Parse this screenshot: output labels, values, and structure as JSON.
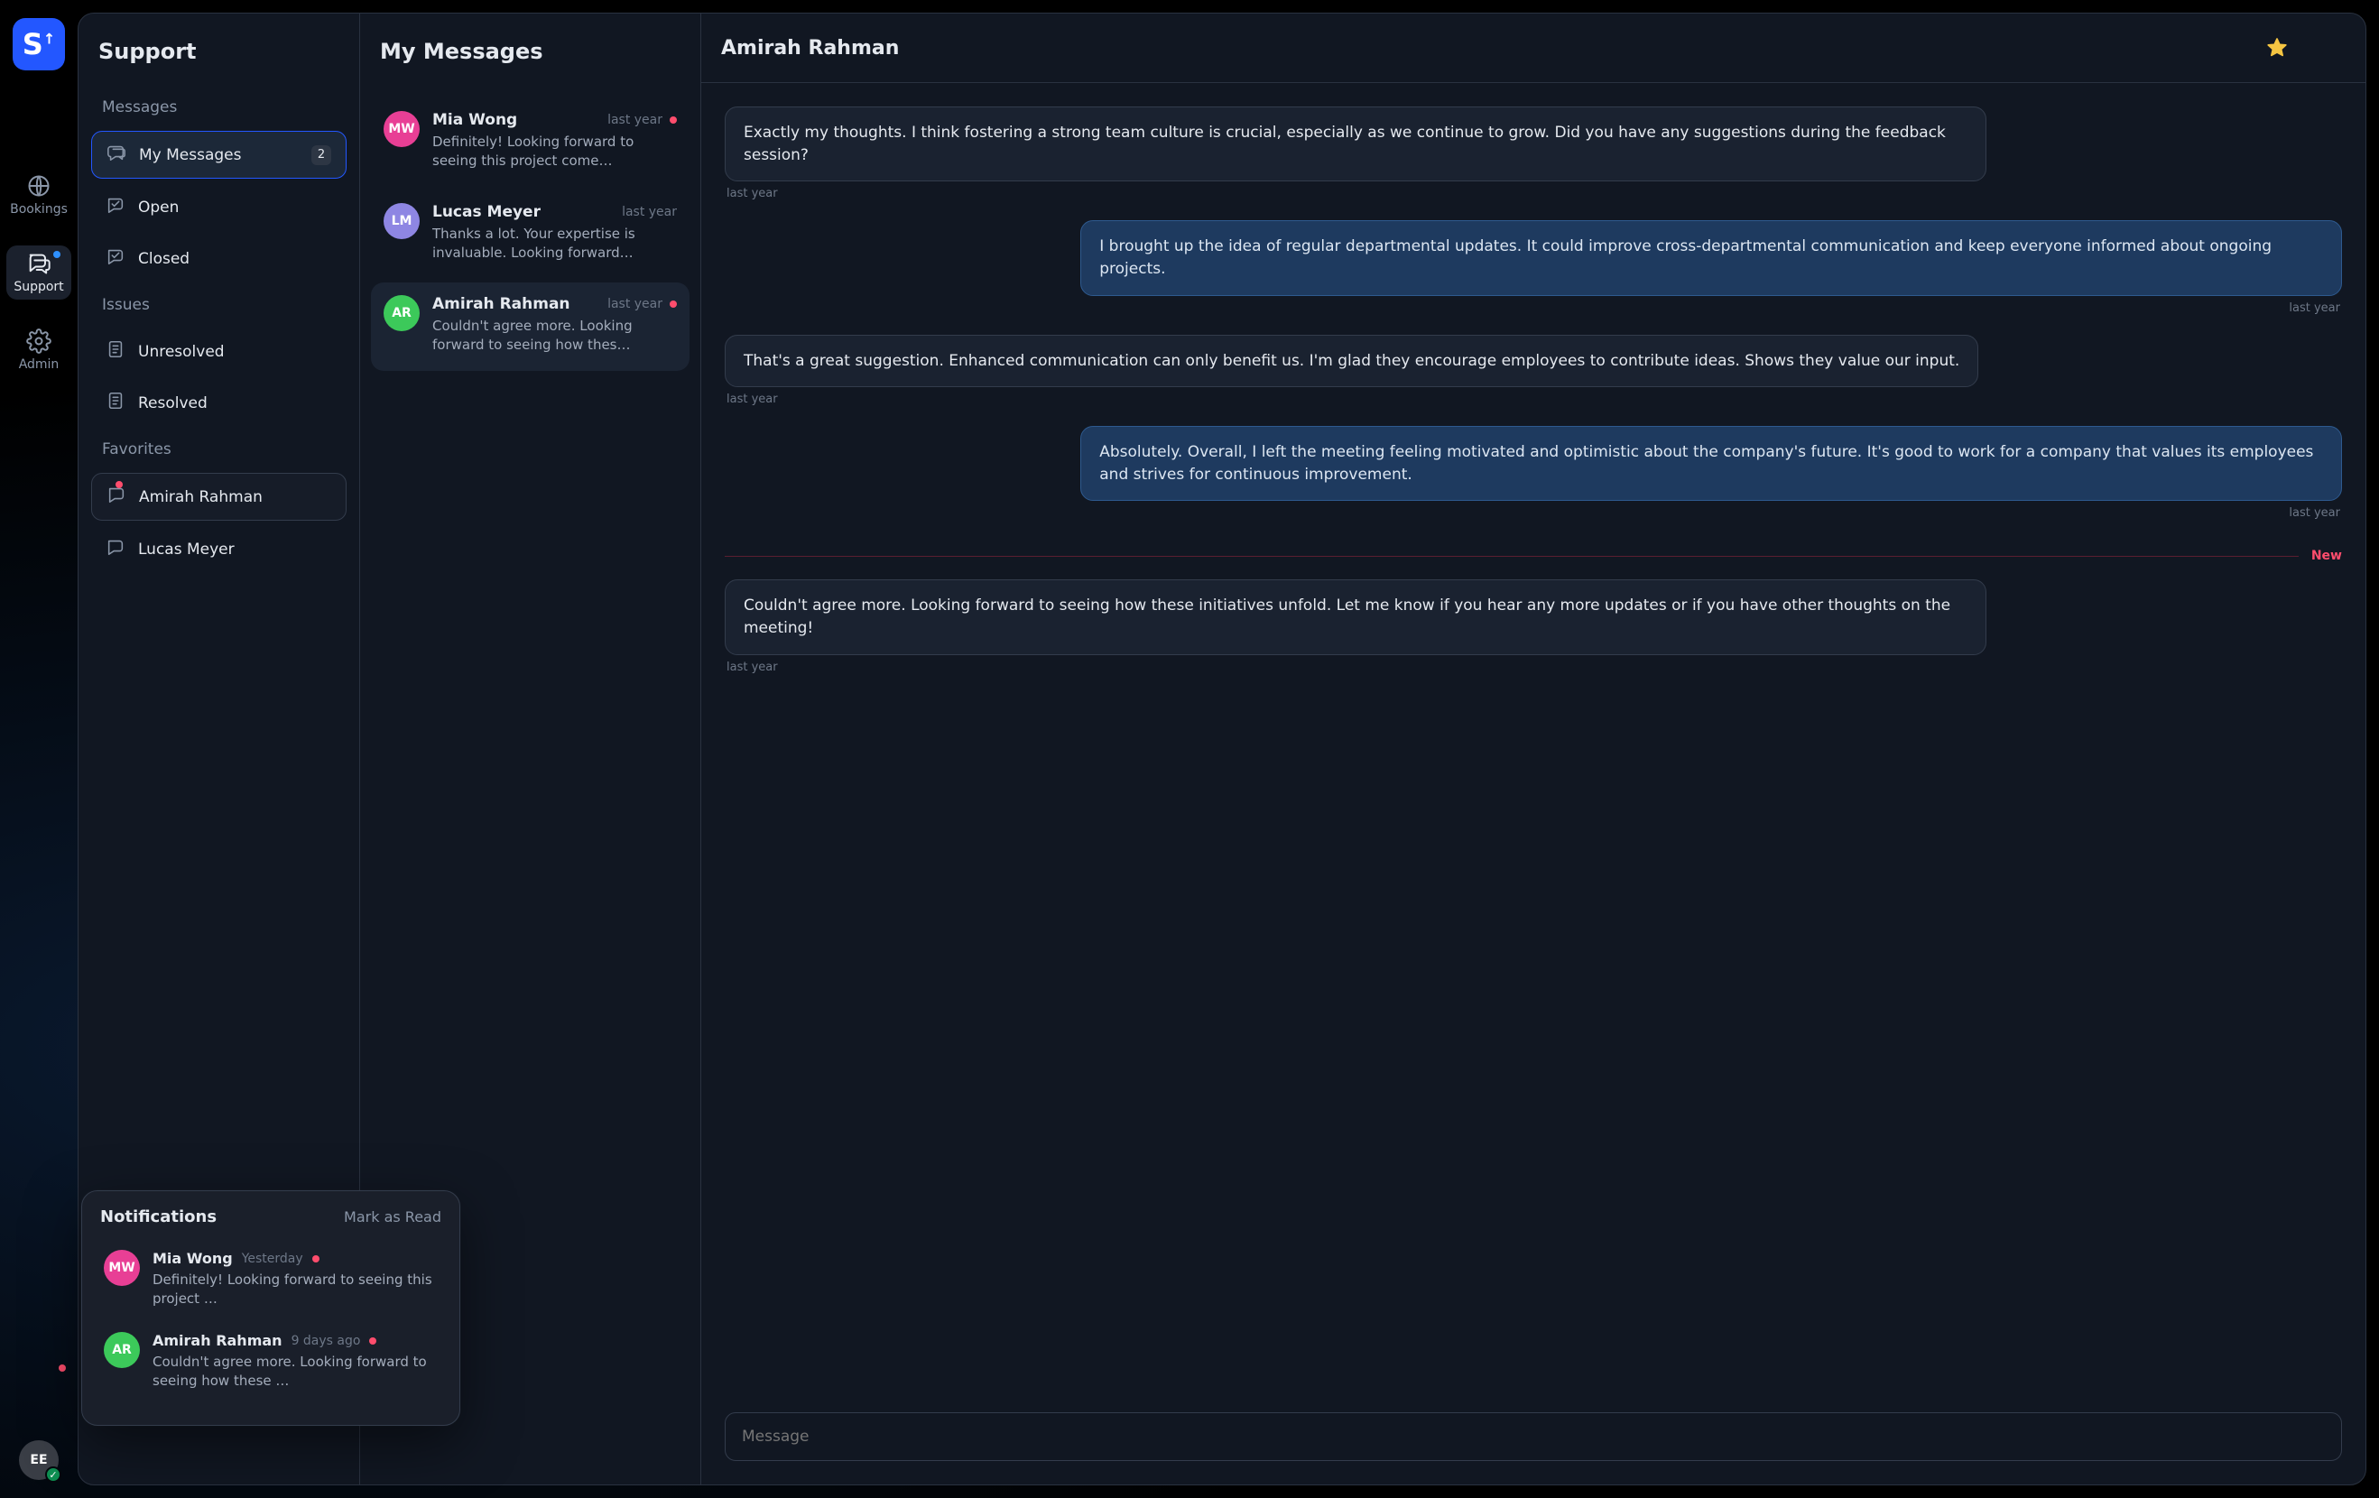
{
  "rail": {
    "items": [
      {
        "icon": "globe",
        "label": "Bookings"
      },
      {
        "icon": "chat",
        "label": "Support",
        "active": true,
        "indicator": true
      },
      {
        "icon": "gear",
        "label": "Admin"
      }
    ],
    "avatar_initials": "EE"
  },
  "support": {
    "title": "Support",
    "sections": [
      {
        "label": "Messages",
        "items": [
          {
            "icon": "chat-bubble",
            "label": "My Messages",
            "count": "2",
            "active": true
          },
          {
            "icon": "check-msg",
            "label": "Open"
          },
          {
            "icon": "check-msg",
            "label": "Closed"
          }
        ]
      },
      {
        "label": "Issues",
        "items": [
          {
            "icon": "doc",
            "label": "Unresolved"
          },
          {
            "icon": "doc",
            "label": "Resolved"
          }
        ]
      },
      {
        "label": "Favorites",
        "items": [
          {
            "icon": "msg",
            "label": "Amirah Rahman",
            "boxed": true,
            "dot": true
          },
          {
            "icon": "msg",
            "label": "Lucas Meyer"
          }
        ]
      }
    ]
  },
  "list": {
    "title": "My Messages",
    "items": [
      {
        "initials": "MW",
        "avatar_class": "av-pink",
        "name": "Mia Wong",
        "time": "last year",
        "unread": true,
        "preview": "Definitely! Looking forward to seeing this project come…"
      },
      {
        "initials": "LM",
        "avatar_class": "av-violet",
        "name": "Lucas Meyer",
        "time": "last year",
        "unread": false,
        "preview": "Thanks a lot. Your expertise is invaluable. Looking forward…"
      },
      {
        "initials": "AR",
        "avatar_class": "av-green",
        "name": "Amirah Rahman",
        "time": "last year",
        "unread": true,
        "active": true,
        "preview": "Couldn't agree more. Looking forward to seeing how thes…"
      }
    ]
  },
  "conversation": {
    "title": "Amirah Rahman",
    "starred": true,
    "messages": [
      {
        "side": "left",
        "text": "Exactly my thoughts. I think fostering a strong team culture is crucial, especially as we continue to grow. Did you have any suggestions during the feedback session?",
        "time": "last year"
      },
      {
        "side": "right",
        "text": "I brought up the idea of regular departmental updates. It could improve cross-departmental communication and keep everyone informed about ongoing projects.",
        "time": "last year"
      },
      {
        "side": "left",
        "text": "That's a great suggestion. Enhanced communication can only benefit us. I'm glad they encourage employees to contribute ideas. Shows they value our input.",
        "time": "last year"
      },
      {
        "side": "right",
        "text": "Absolutely. Overall, I left the meeting feeling motivated and optimistic about the company's future. It's good to work for a company that values its employees and strives for continuous improvement.",
        "time": "last year"
      }
    ],
    "new_separator_label": "New",
    "after_new": [
      {
        "side": "left",
        "text": "Couldn't agree more. Looking forward to seeing how these initiatives unfold. Let me know if you hear any more updates or if you have other thoughts on the meeting!",
        "time": "last year"
      }
    ],
    "composer_placeholder": "Message"
  },
  "notifications": {
    "title": "Notifications",
    "action": "Mark as Read",
    "items": [
      {
        "initials": "MW",
        "avatar_class": "av-pink",
        "name": "Mia Wong",
        "time": "Yesterday",
        "unread": true,
        "text": "Definitely! Looking forward to seeing this project …"
      },
      {
        "initials": "AR",
        "avatar_class": "av-green",
        "name": "Amirah Rahman",
        "time": "9 days ago",
        "unread": true,
        "text": "Couldn't agree more. Looking forward to seeing how these …"
      }
    ]
  }
}
